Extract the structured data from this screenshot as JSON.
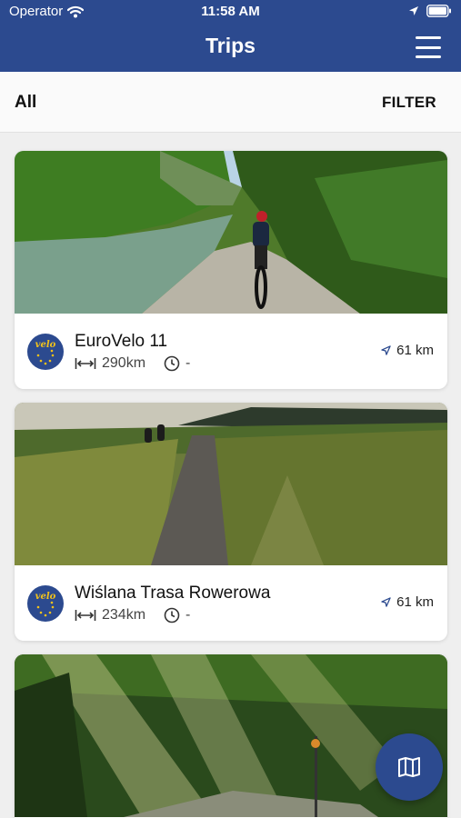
{
  "status_bar": {
    "carrier": "Operator",
    "time": "11:58 AM"
  },
  "nav": {
    "title": "Trips",
    "menu_icon": "hamburger-menu-icon"
  },
  "filter_bar": {
    "selected": "All",
    "filter_label": "FILTER"
  },
  "trips": [
    {
      "title": "EuroVelo 11",
      "length": "290km",
      "duration": "-",
      "distance_away": "61 km",
      "logo_text": "velo"
    },
    {
      "title": "Wiślana Trasa Rowerowa",
      "length": "234km",
      "duration": "-",
      "distance_away": "61 km",
      "logo_text": "velo"
    }
  ],
  "colors": {
    "brand": "#2c4a8f",
    "logo_accent": "#f1c21b"
  },
  "fab": {
    "icon": "map-icon"
  }
}
